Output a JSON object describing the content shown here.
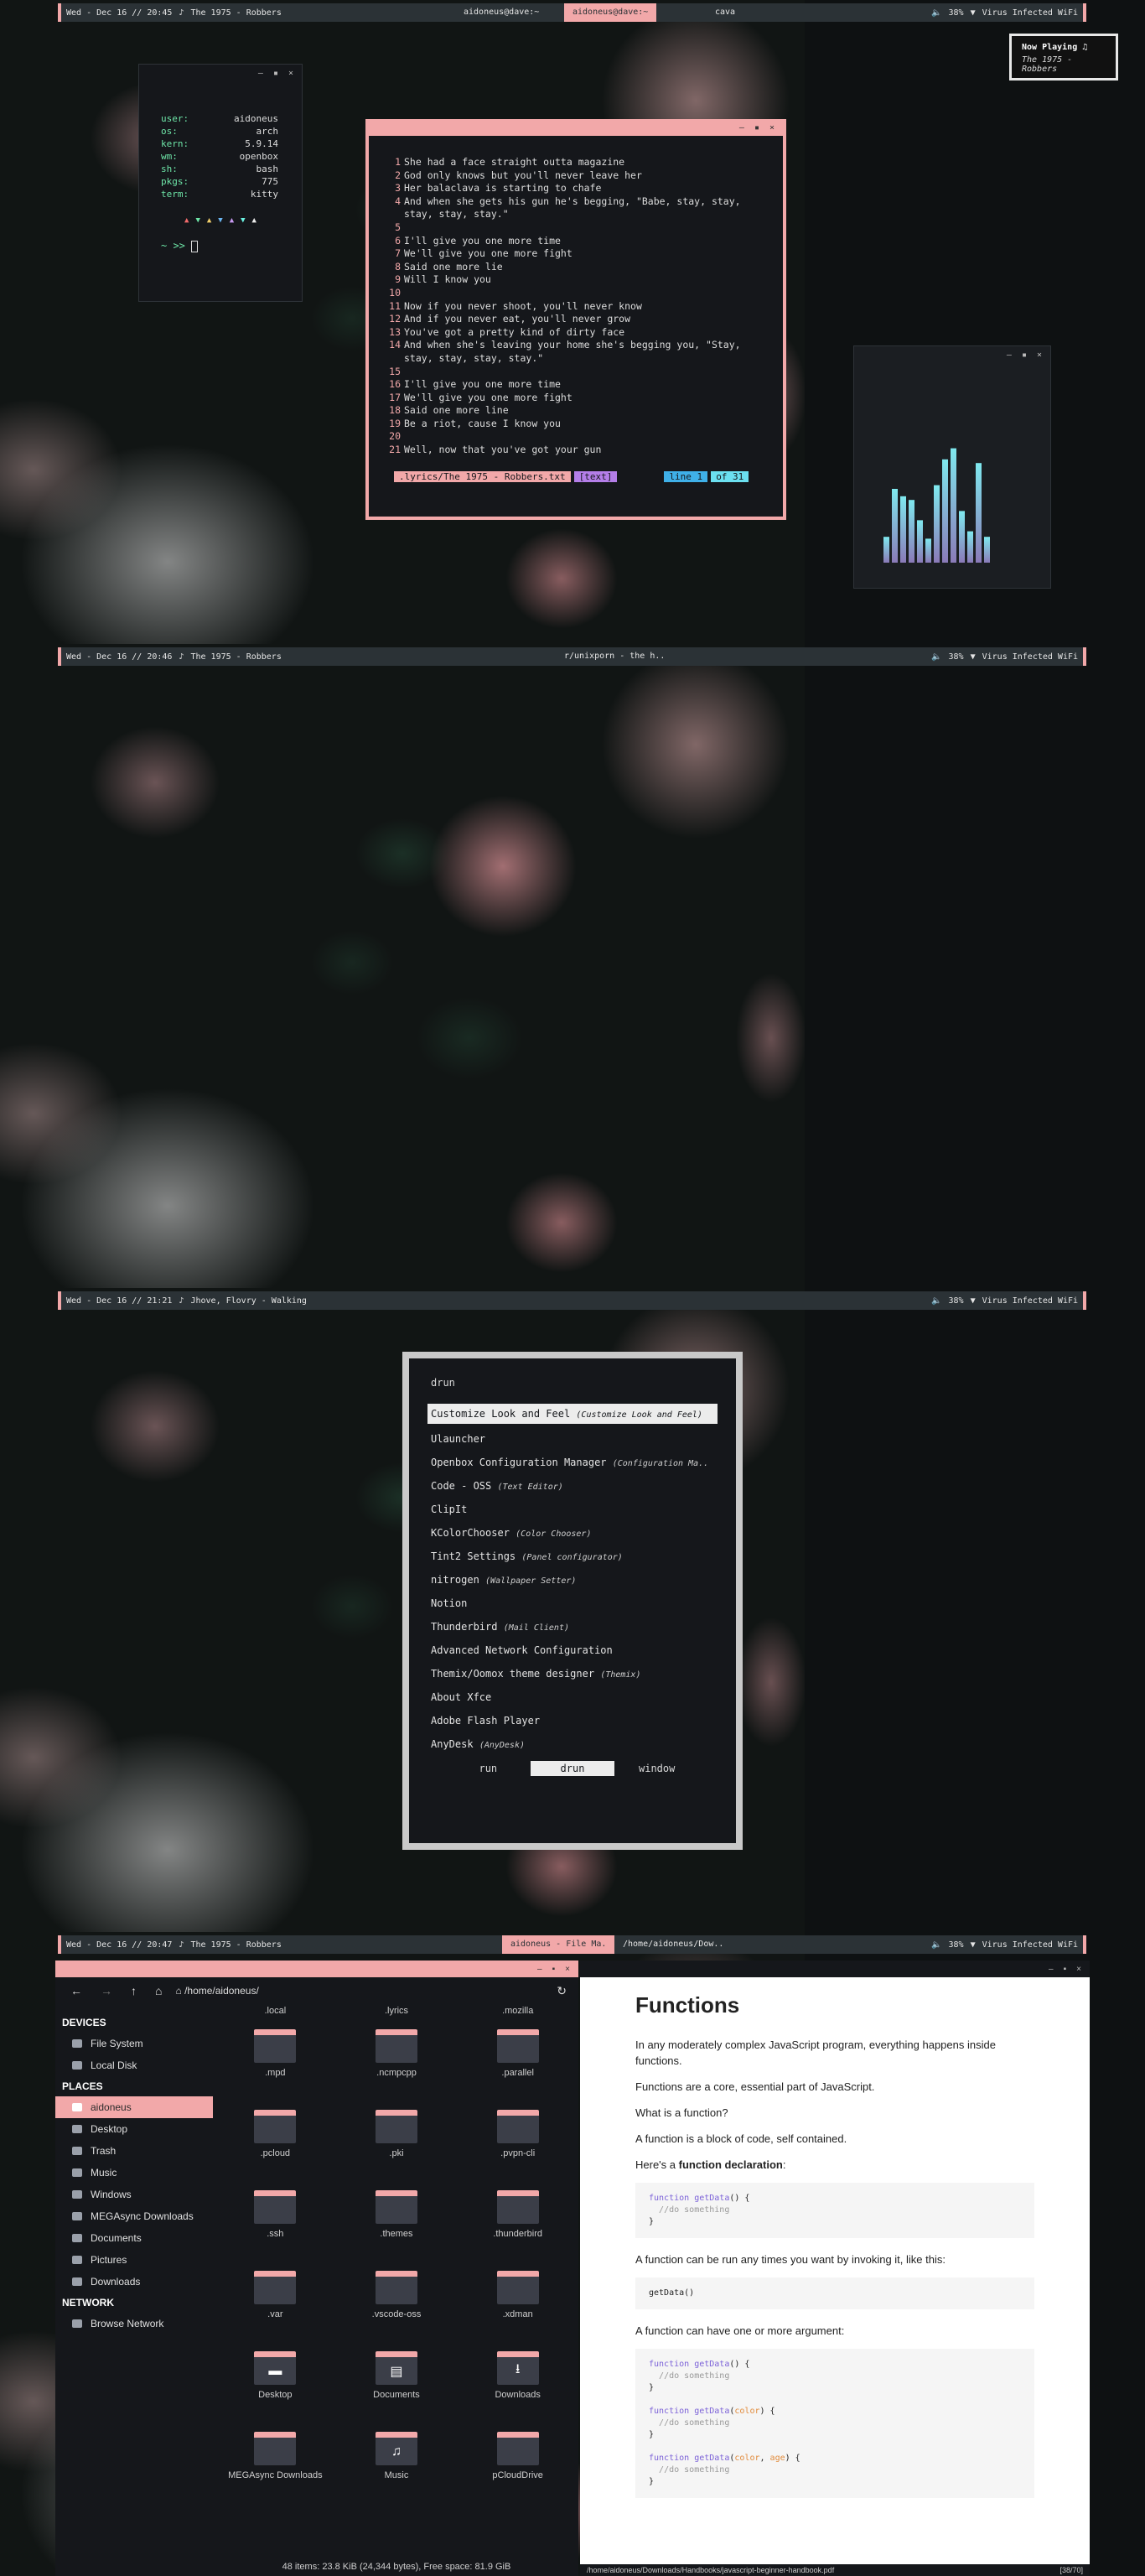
{
  "shots": [
    {
      "bar": {
        "date": "Wed - Dec 16 // 20:45",
        "song": "The 1975 - Robbers",
        "tasks": [
          "aidoneus@dave:~",
          "aidoneus@dave:~",
          "cava"
        ],
        "battery": "38%",
        "wifi": "Virus Infected WiFi"
      }
    },
    {
      "bar": {
        "date": "Wed - Dec 16 // 20:46",
        "song": "The 1975 - Robbers",
        "tasks": [
          "r/unixporn - the h.."
        ],
        "battery": "38%",
        "wifi": "Virus Infected WiFi"
      }
    },
    {
      "bar": {
        "date": "Wed - Dec 16 // 21:21",
        "song": "Jhove, Flovry - Walking",
        "battery": "38%",
        "wifi": "Virus Infected WiFi"
      }
    },
    {
      "bar": {
        "date": "Wed - Dec 16 // 20:47",
        "song": "The 1975 - Robbers",
        "tasks": [
          "aidoneus - File Ma.",
          "/home/aidoneus/Dow.."
        ],
        "battery": "38%",
        "wifi": "Virus Infected WiFi"
      }
    }
  ],
  "now_playing": {
    "title": "Now Playing ♫",
    "song": "The 1975 - Robbers"
  },
  "fetch": {
    "rows": [
      {
        "k": "user:",
        "v": "aidoneus"
      },
      {
        "k": "os:",
        "v": "arch"
      },
      {
        "k": "kern:",
        "v": "5.9.14"
      },
      {
        "k": "wm:",
        "v": "openbox"
      },
      {
        "k": "sh:",
        "v": "bash"
      },
      {
        "k": "pkgs:",
        "v": "775"
      },
      {
        "k": "term:",
        "v": "kitty"
      }
    ],
    "prompt": "~ >>"
  },
  "editor": {
    "lines": [
      {
        "n": "1",
        "t": "She had a face straight outta magazine"
      },
      {
        "n": "2",
        "t": "God only knows but you'll never leave her"
      },
      {
        "n": "3",
        "t": "Her balaclava is starting to chafe"
      },
      {
        "n": "4",
        "t": "And when she gets his gun he's begging, \"Babe, stay, stay,\nstay, stay, stay.\""
      },
      {
        "n": "5",
        "t": ""
      },
      {
        "n": "6",
        "t": "I'll give you one more time"
      },
      {
        "n": "7",
        "t": "We'll give you one more fight"
      },
      {
        "n": "8",
        "t": "Said one more lie"
      },
      {
        "n": "9",
        "t": "Will I know you"
      },
      {
        "n": "10",
        "t": ""
      },
      {
        "n": "11",
        "t": "Now if you never shoot, you'll never know"
      },
      {
        "n": "12",
        "t": "And if you never eat, you'll never grow"
      },
      {
        "n": "13",
        "t": "You've got a pretty kind of dirty face"
      },
      {
        "n": "14",
        "t": "And when she's leaving your home she's begging you, \"Stay,\nstay, stay, stay, stay.\""
      },
      {
        "n": "15",
        "t": ""
      },
      {
        "n": "16",
        "t": "I'll give you one more time"
      },
      {
        "n": "17",
        "t": "We'll give you one more fight"
      },
      {
        "n": "18",
        "t": "Said one more line"
      },
      {
        "n": "19",
        "t": "Be a riot, cause I know you"
      },
      {
        "n": "20",
        "t": ""
      },
      {
        "n": "21",
        "t": "Well, now that you've got your gun"
      }
    ],
    "file": ".lyrics/The 1975 - Robbers.txt",
    "mode": "[text]",
    "line": "line 1",
    "of": "of 31"
  },
  "cava": {
    "levels": [
      0.14,
      0.4,
      0.36,
      0.34,
      0.23,
      0.13,
      0.42,
      0.56,
      0.62,
      0.28,
      0.17,
      0.54,
      0.14
    ]
  },
  "rofi": {
    "prompt": "drun",
    "items": [
      {
        "name": "Customize Look and Feel",
        "desc": "(Customize Look and Feel)"
      },
      {
        "name": "Ulauncher",
        "desc": ""
      },
      {
        "name": "Openbox Configuration Manager",
        "desc": "(Configuration Ma.."
      },
      {
        "name": "Code - OSS",
        "desc": "(Text Editor)"
      },
      {
        "name": "ClipIt",
        "desc": ""
      },
      {
        "name": "KColorChooser",
        "desc": "(Color Chooser)"
      },
      {
        "name": "Tint2 Settings",
        "desc": "(Panel configurator)"
      },
      {
        "name": "nitrogen",
        "desc": "(Wallpaper Setter)"
      },
      {
        "name": "Notion",
        "desc": ""
      },
      {
        "name": "Thunderbird",
        "desc": "(Mail Client)"
      },
      {
        "name": "Advanced Network Configuration",
        "desc": ""
      },
      {
        "name": "Themix/Oomox theme designer",
        "desc": "(Themix)"
      },
      {
        "name": "About Xfce",
        "desc": ""
      },
      {
        "name": "Adobe Flash Player",
        "desc": ""
      },
      {
        "name": "AnyDesk",
        "desc": "(AnyDesk)"
      }
    ],
    "modes": [
      "run",
      "drun",
      "window"
    ]
  },
  "fm": {
    "path": "/home/aidoneus/",
    "devices_h": "DEVICES",
    "devices": [
      "File System",
      "Local Disk"
    ],
    "places_h": "PLACES",
    "places": [
      "aidoneus",
      "Desktop",
      "Trash",
      "Music",
      "Windows",
      "MEGAsync Downloads",
      "Documents",
      "Pictures",
      "Downloads"
    ],
    "network_h": "NETWORK",
    "network": [
      "Browse Network"
    ],
    "top_row": [
      ".local",
      ".lyrics",
      ".mozilla"
    ],
    "folders": [
      ".mpd",
      ".ncmpcpp",
      ".parallel",
      ".pcloud",
      ".pki",
      ".pvpn-cli",
      ".ssh",
      ".themes",
      ".thunderbird",
      ".var",
      ".vscode-oss",
      ".xdman",
      "Desktop",
      "Documents",
      "Downloads",
      "MEGAsync Downloads",
      "Music",
      "pCloudDrive"
    ],
    "status": "48 items: 23.8 KiB (24,344 bytes), Free space: 81.9 GiB"
  },
  "pdf": {
    "h1": "Functions",
    "p1": "In any moderately complex JavaScript program, everything happens inside functions.",
    "p2": "Functions are a core, essential part of JavaScript.",
    "p3": "What is a function?",
    "p4": "A function is a block of code, self contained.",
    "p5a": "Here's a ",
    "p5b": "function declaration",
    "p5c": ":",
    "p6": "A function can be run any times you want by invoking it, like this:",
    "p7": "A function can have one or more argument:",
    "kw": "function",
    "fn": "getData",
    "cm": "//do something",
    "call": "getData()",
    "a1": "color",
    "a2": "age",
    "path": "/home/aidoneus/Downloads/Handbooks/javascript-beginner-handbook.pdf",
    "page": "[38/70]"
  },
  "colors": {
    "accent": "#f2a8a9",
    "bar_bg": "#2b3236",
    "cava_top": "#7fe9ef",
    "cava_bottom": "#8a7ab8"
  }
}
